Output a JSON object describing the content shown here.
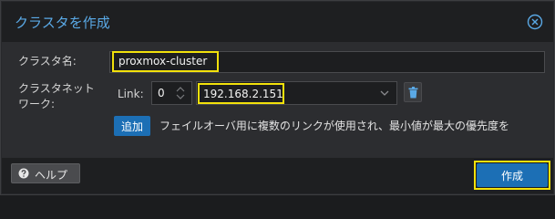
{
  "dialog": {
    "title": "クラスタを作成",
    "cluster_name_label": "クラスタ名:",
    "cluster_name_value": "proxmox-cluster",
    "network_label_line1": "クラスタネット",
    "network_label_line2": "ワーク:",
    "link_label": "Link:",
    "link_value": "0",
    "ip_value": "192.168.2.151",
    "add_label": "追加",
    "add_hint": "フェイルオーバ用に複数のリンクが使用され、最小値が最大の優先度を"
  },
  "footer": {
    "help_label": "ヘルプ",
    "create_label": "作成"
  },
  "colors": {
    "accent": "#5aa9e6",
    "highlight": "#f2e10b",
    "primary_button": "#1c6fb5"
  }
}
